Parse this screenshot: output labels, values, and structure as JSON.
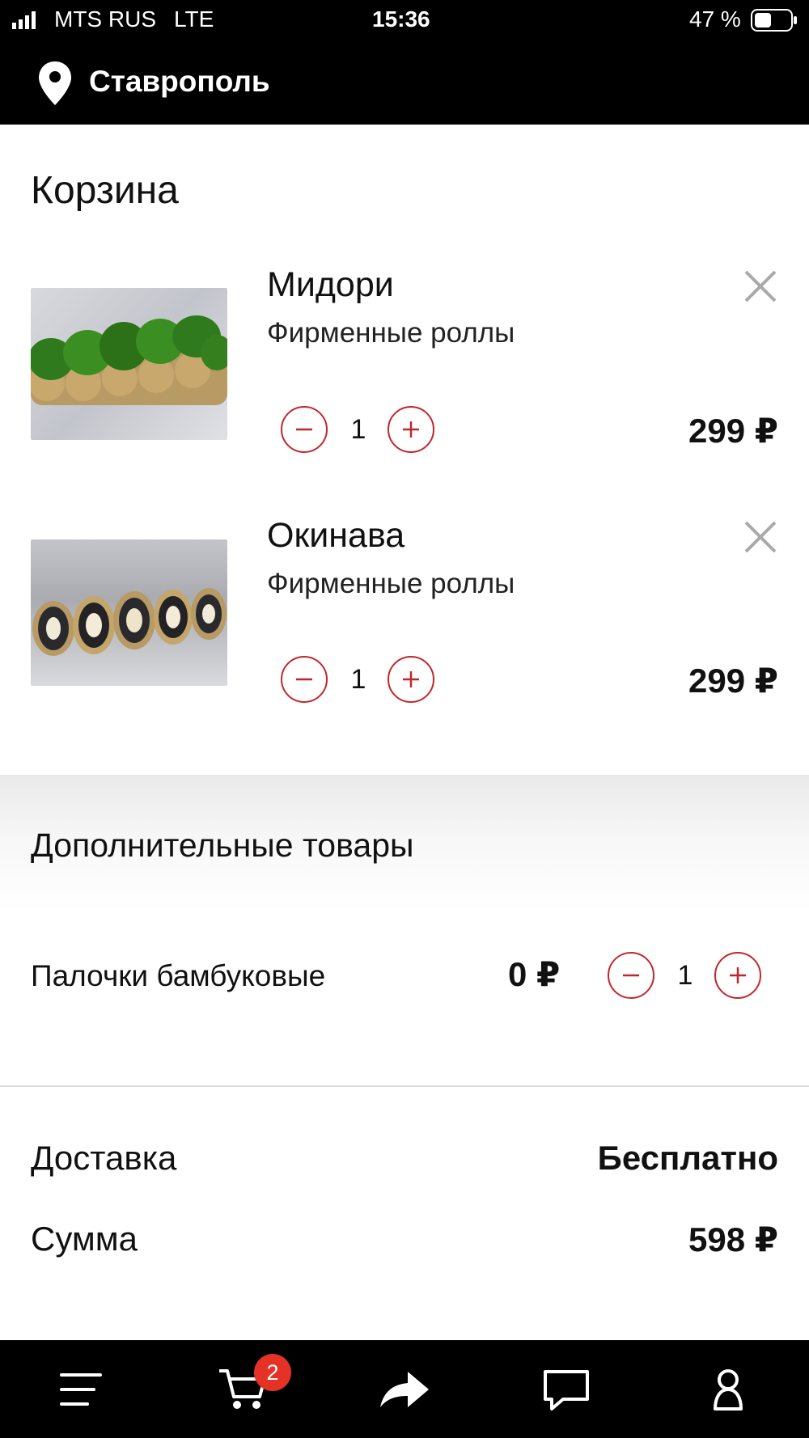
{
  "status_bar": {
    "carrier": "MTS RUS",
    "network": "LTE",
    "time": "15:36",
    "battery": "47 %"
  },
  "header": {
    "city": "Ставрополь",
    "location_icon": "location-pin-icon"
  },
  "page": {
    "title": "Корзина"
  },
  "cart": {
    "items": [
      {
        "name": "Мидори",
        "category": "Фирменные роллы",
        "quantity": "1",
        "price": "299 ₽"
      },
      {
        "name": "Окинава",
        "category": "Фирменные роллы",
        "quantity": "1",
        "price": "299 ₽"
      }
    ]
  },
  "extras": {
    "title": "Дополнительные товары",
    "items": [
      {
        "name": "Палочки бамбуковые",
        "price": "0 ₽",
        "quantity": "1"
      }
    ]
  },
  "summary": {
    "delivery_label": "Доставка",
    "delivery_value": "Бесплатно",
    "total_label": "Сумма",
    "total_value": "598 ₽"
  },
  "bottom_nav": {
    "cart_badge": "2",
    "items": [
      "menu-icon",
      "cart-icon",
      "share-icon",
      "chat-icon",
      "profile-icon"
    ]
  },
  "colors": {
    "accent": "#c0272d",
    "badge": "#e53227",
    "bars": "#000000"
  }
}
